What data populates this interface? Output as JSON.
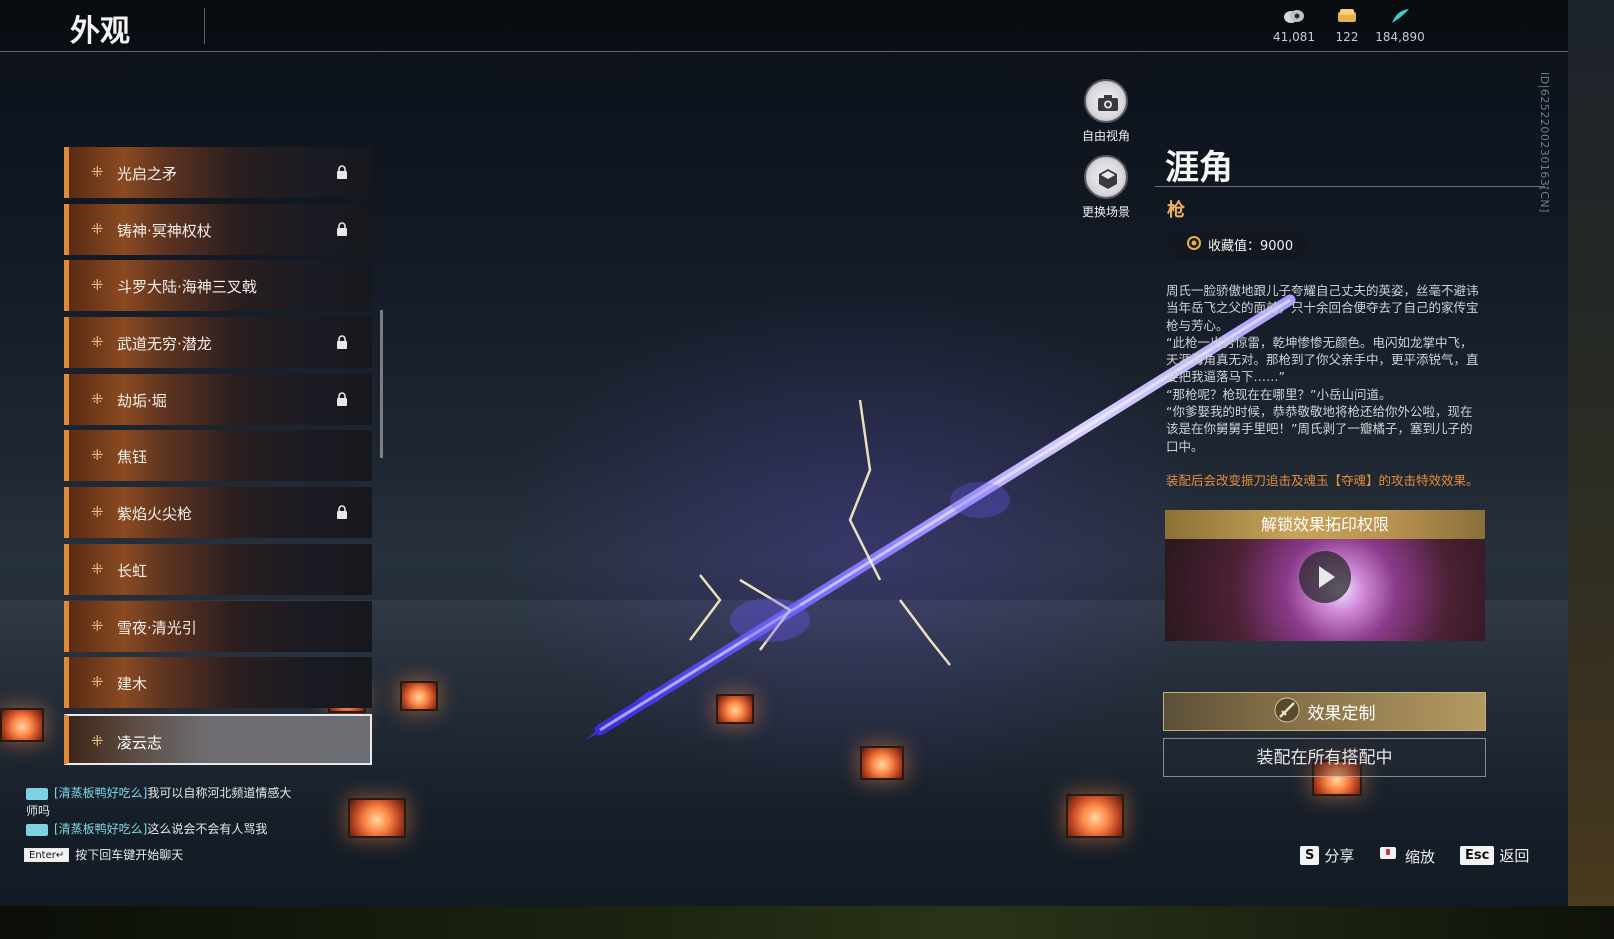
{
  "header": {
    "title": "外观",
    "currencies": [
      {
        "icon": "eye-coin-icon",
        "value": "41,081"
      },
      {
        "icon": "gold-ticket-icon",
        "value": "122"
      },
      {
        "icon": "feather-icon",
        "value": "184,890"
      }
    ]
  },
  "skin_list": [
    {
      "label": "光启之矛",
      "locked": true
    },
    {
      "label": "铸神·冥神权杖",
      "locked": true
    },
    {
      "label": "斗罗大陆·海神三叉戟",
      "locked": false
    },
    {
      "label": "武道无穷·潜龙",
      "locked": true
    },
    {
      "label": "劫垢·堀",
      "locked": true
    },
    {
      "label": "焦钰",
      "locked": false
    },
    {
      "label": "紫焰火尖枪",
      "locked": true
    },
    {
      "label": "长虹",
      "locked": false
    },
    {
      "label": "雪夜·清光引",
      "locked": false
    },
    {
      "label": "建木",
      "locked": false
    },
    {
      "label": "凌云志",
      "locked": false,
      "selected": true
    }
  ],
  "view_controls": {
    "free_camera_label": "自由视角",
    "change_scene_label": "更换场景"
  },
  "detail": {
    "name": "涯角",
    "type": "枪",
    "collection": "收藏值：9000",
    "description": [
      "周氏一脸骄傲地跟儿子夸耀自己丈夫的英姿，丝毫不避讳当年岳飞之父的面前，只十余回合便夺去了自己的家传宝枪与芳心。",
      "“此枪一出势惊雷，乾坤惨惨无颜色。电闪如龙掌中飞，天涯海角真无对。那枪到了你父亲手中，更平添锐气，直要把我逼落马下……”",
      "“那枪呢？枪现在在哪里？”小岳山问道。",
      "“你爹娶我的时候，恭恭敬敬地将枪还给你外公啦，现在该是在你舅舅手里吧！”周氏剥了一瓣橘子，塞到儿子的口中。"
    ],
    "effect_note": "装配后会改变振刀追击及魂玉【夺魂】的攻击特效效果。",
    "unlock_title": "解锁效果拓印权限",
    "customize_label": "效果定制",
    "equip_label": "装配在所有搭配中"
  },
  "chat": {
    "messages": [
      {
        "user": "[清蒸板鸭好吃么]",
        "text": "我可以自称河北频道情感大师吗"
      },
      {
        "user": "[清蒸板鸭好吃么]",
        "text": "这么说会不会有人骂我"
      }
    ],
    "hint_key": "Enter↵",
    "hint_text": "按下回车键开始聊天"
  },
  "footer": {
    "share": {
      "key": "S",
      "label": "分享"
    },
    "zoom": {
      "label": "缩放"
    },
    "back": {
      "key": "Esc",
      "label": "返回"
    }
  },
  "player_id": "ID|6252200230163[CN]",
  "colors": {
    "accent_orange": "#e08a3a",
    "gold": "#c8a45a",
    "note_orange": "#e48c3a"
  }
}
